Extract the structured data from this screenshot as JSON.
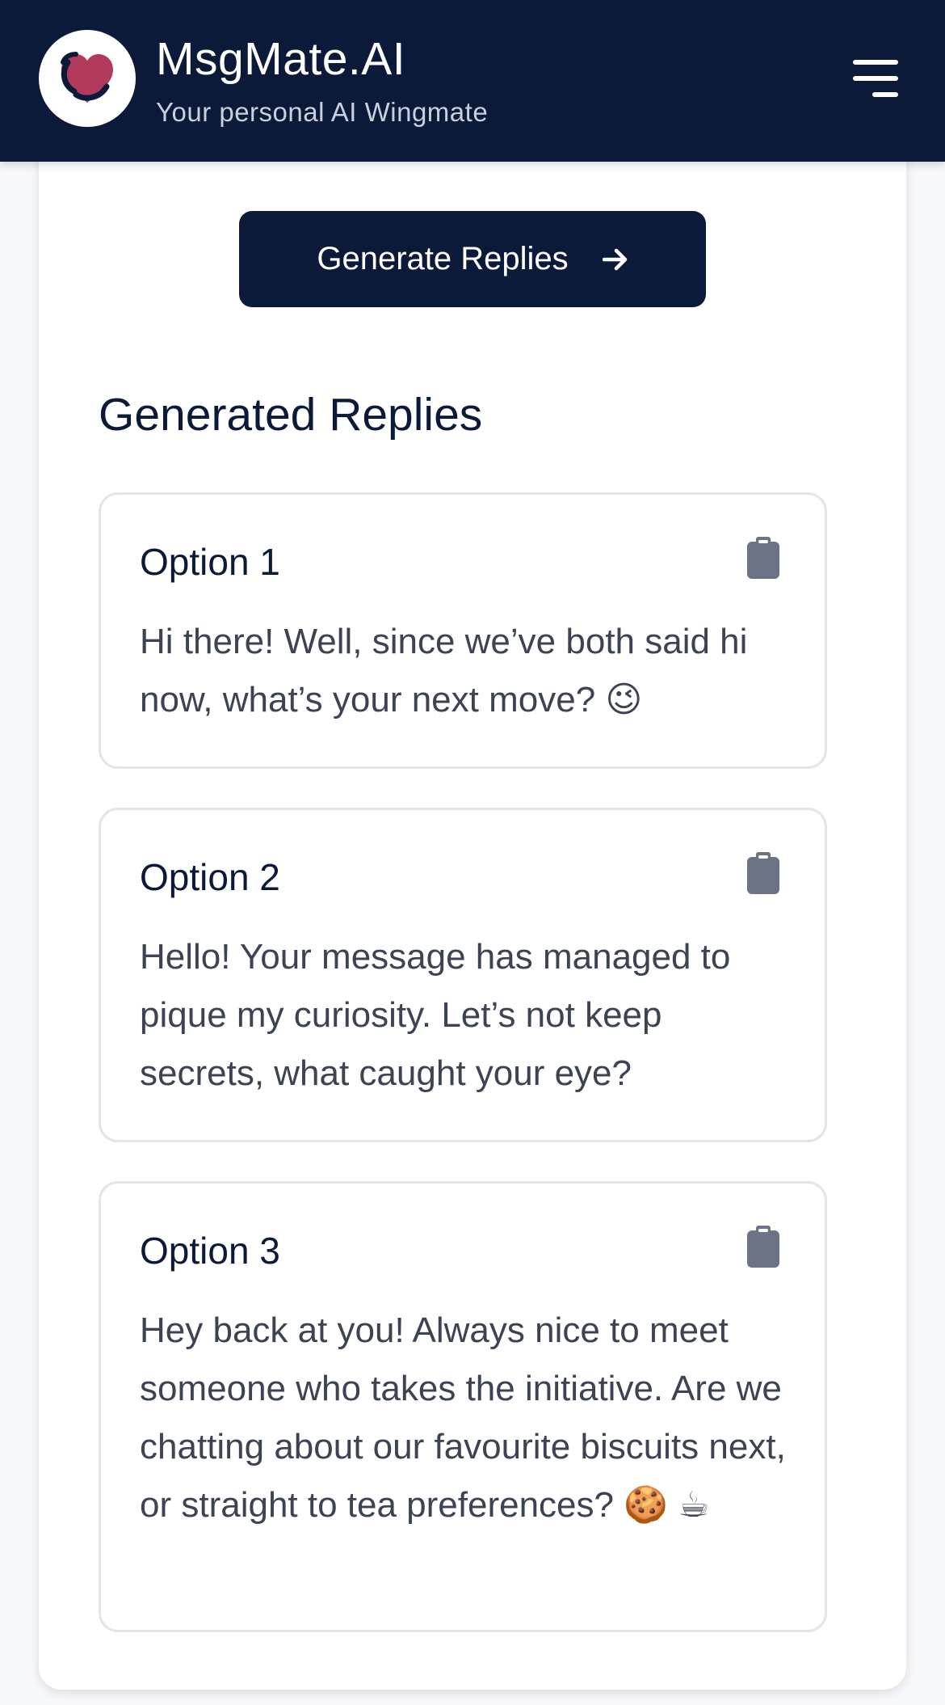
{
  "header": {
    "title": "MsgMate.AI",
    "subtitle": "Your personal AI Wingmate",
    "logo_icon": "heart-icon",
    "menu_icon": "hamburger-menu-icon"
  },
  "main": {
    "generate_button_label": "Generate Replies",
    "generate_button_icon": "arrow-right-icon",
    "section_title": "Generated Replies",
    "replies": [
      {
        "label": "Option 1",
        "text": "Hi there! Well, since we’ve both said hi now, what’s your next move? 😉",
        "copy_icon": "clipboard-icon"
      },
      {
        "label": "Option 2",
        "text": "Hello! Your message has managed to pique my curiosity. Let’s not keep secrets, what caught your eye?",
        "copy_icon": "clipboard-icon"
      },
      {
        "label": "Option 3",
        "text": "Hey back at you! Always nice to meet someone who takes the initiative. Are we chatting about our favourite biscuits next, or straight to tea preferences? 🍪 ☕",
        "copy_icon": "clipboard-icon"
      }
    ]
  },
  "colors": {
    "navy": "#0b1a38",
    "heart": "#b23a5c",
    "icon_gray": "#6b7385",
    "text_gray": "#3c4353",
    "border": "#e3e5ea"
  }
}
